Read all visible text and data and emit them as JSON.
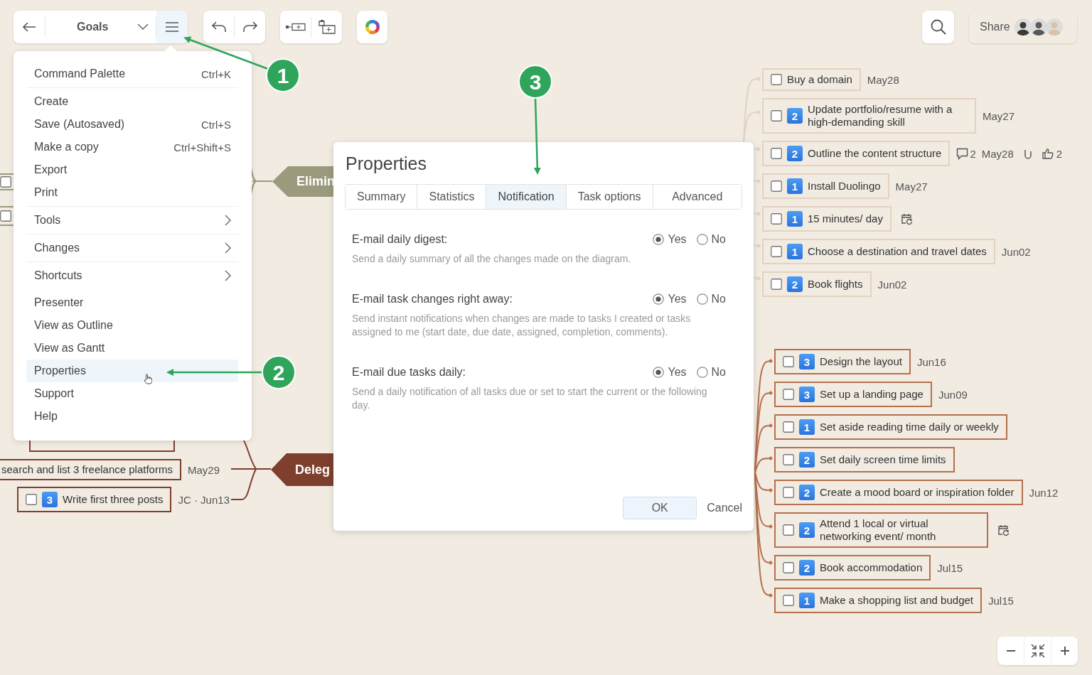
{
  "toolbar": {
    "title": "Goals",
    "menu_open": true
  },
  "share": {
    "label": "Share",
    "avatars": [
      {
        "kind": "avatar"
      },
      {
        "kind": "avatar"
      },
      {
        "kind": "avatar"
      }
    ]
  },
  "menu": {
    "sections": [
      {
        "items": [
          {
            "label": "Command Palette",
            "shortcut": "Ctrl+K",
            "has_submenu": false,
            "selected": false
          }
        ]
      },
      {
        "items": [
          {
            "label": "Create",
            "has_submenu": false,
            "selected": false
          },
          {
            "label": "Save (Autosaved)",
            "shortcut": "Ctrl+S",
            "has_submenu": false,
            "selected": false
          },
          {
            "label": "Make a copy",
            "shortcut": "Ctrl+Shift+S",
            "has_submenu": false,
            "selected": false
          },
          {
            "label": "Export",
            "has_submenu": false,
            "selected": false
          },
          {
            "label": "Print",
            "has_submenu": false,
            "selected": false
          }
        ]
      },
      {
        "items": [
          {
            "label": "Tools",
            "has_submenu": true,
            "selected": false
          }
        ]
      },
      {
        "items": [
          {
            "label": "Changes",
            "has_submenu": true,
            "selected": false
          }
        ]
      },
      {
        "items": [
          {
            "label": "Shortcuts",
            "has_submenu": true,
            "selected": false
          }
        ]
      },
      {
        "items": [
          {
            "label": "Presenter",
            "has_submenu": false,
            "selected": false
          },
          {
            "label": "View as Outline",
            "has_submenu": false,
            "selected": false
          },
          {
            "label": "View as Gantt",
            "has_submenu": false,
            "selected": false
          },
          {
            "label": "Properties",
            "has_submenu": false,
            "selected": true
          },
          {
            "label": "Support",
            "has_submenu": false,
            "selected": false
          },
          {
            "label": "Help",
            "has_submenu": false,
            "selected": false
          }
        ]
      }
    ]
  },
  "mind_map": {
    "topics": [
      {
        "label": "Elimin",
        "color": "#9c9a7d"
      },
      {
        "label": "Deleg",
        "color": "#7e3f2d"
      }
    ],
    "partial_nodes": [
      {
        "checked": false
      },
      {
        "checked": false
      }
    ],
    "left_nodes": [
      {
        "text": "search and list 3 freelance platforms",
        "date": "May29"
      },
      {
        "text": "Write first three posts",
        "priority": "3",
        "checked": false,
        "date": "JC · Jun13"
      }
    ],
    "right_groups": [
      {
        "color": "#e4d2bf",
        "nodes": [
          {
            "text": "Buy a domain",
            "checked": false,
            "date": "May28"
          },
          {
            "text": "Update portfolio/resume with a high-demanding skill",
            "priority": "2",
            "checked": false,
            "date": "May27"
          },
          {
            "text": "Outline the content structure",
            "priority": "2",
            "checked": false,
            "comments": "2",
            "date": "May28",
            "attachment": true,
            "likes": "2"
          },
          {
            "text": "Install Duolingo",
            "priority": "1",
            "checked": false,
            "date": "May27"
          },
          {
            "text": "15 minutes/ day",
            "priority": "1",
            "checked": false,
            "recurring": true
          },
          {
            "text": "Choose a destination and travel dates",
            "priority": "1",
            "checked": false,
            "date": "Jun02"
          },
          {
            "text": "Book flights",
            "priority": "2",
            "checked": false,
            "date": "Jun02"
          }
        ]
      },
      {
        "color": "#b5704d",
        "nodes": [
          {
            "text": "Design the layout",
            "priority": "3",
            "checked": false,
            "date": "Jun16"
          },
          {
            "text": "Set up a landing page",
            "priority": "3",
            "checked": false,
            "date": "Jun09"
          },
          {
            "text": "Set aside reading time daily or weekly",
            "priority": "1",
            "checked": false
          },
          {
            "text": "Set daily screen time limits",
            "priority": "2",
            "checked": false
          },
          {
            "text": "Create a mood board or inspiration folder",
            "priority": "2",
            "checked": false,
            "date": "Jun12"
          },
          {
            "text": "Attend 1 local or virtual networking event/ month",
            "priority": "2",
            "checked": false,
            "recurring": true
          },
          {
            "text": "Book accommodation",
            "priority": "2",
            "checked": false,
            "date": "Jul15"
          },
          {
            "text": "Make a shopping list and budget",
            "priority": "1",
            "checked": false,
            "date": "Jul15"
          }
        ]
      }
    ]
  },
  "dialog": {
    "title": "Properties",
    "tabs": [
      {
        "label": "Summary",
        "selected": false
      },
      {
        "label": "Statistics",
        "selected": false
      },
      {
        "label": "Notification",
        "selected": true
      },
      {
        "label": "Task options",
        "selected": false
      },
      {
        "label": "Advanced",
        "selected": false
      }
    ],
    "settings": [
      {
        "label": "E-mail daily digest:",
        "description": "Send a daily summary of all the changes made on the diagram.",
        "options": [
          {
            "label": "Yes",
            "selected": true
          },
          {
            "label": "No",
            "selected": false
          }
        ]
      },
      {
        "label": "E-mail task changes right away:",
        "description": "Send instant notifications when changes are made to tasks I created or tasks assigned to me (start date, due date, assigned, completion, comments).",
        "options": [
          {
            "label": "Yes",
            "selected": true
          },
          {
            "label": "No",
            "selected": false
          }
        ]
      },
      {
        "label": "E-mail due tasks daily:",
        "description": "Send a daily notification of all tasks due or set to start the current or the following day.",
        "options": [
          {
            "label": "Yes",
            "selected": true
          },
          {
            "label": "No",
            "selected": false
          }
        ]
      }
    ],
    "buttons": [
      {
        "label": "OK",
        "kind": "primary"
      },
      {
        "label": "Cancel",
        "kind": "plain"
      }
    ]
  },
  "callouts": [
    {
      "number": "1"
    },
    {
      "number": "2"
    },
    {
      "number": "3"
    }
  ]
}
